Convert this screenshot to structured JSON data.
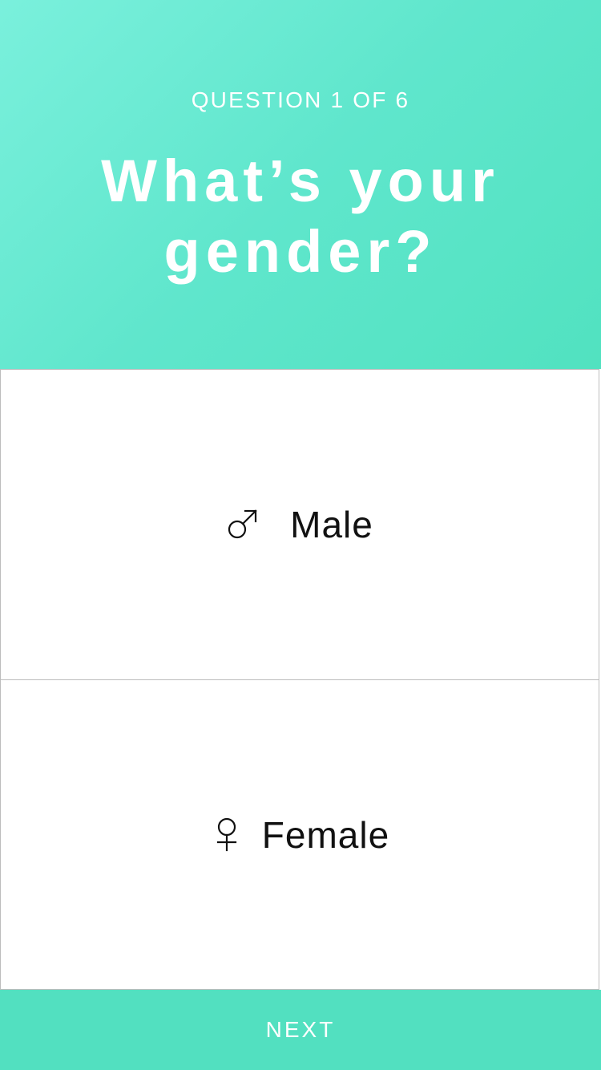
{
  "header": {
    "progress": "QUESTION 1 OF 6",
    "title_line_1": "What’s your",
    "title_line_2": "gender?"
  },
  "options": [
    {
      "label": "Male",
      "icon": "male-symbol-icon"
    },
    {
      "label": "Female",
      "icon": "female-symbol-icon"
    }
  ],
  "footer": {
    "next_label": "NEXT"
  },
  "colors": {
    "header_gradient_start": "#7af0dc",
    "header_gradient_end": "#51e2c0",
    "next_bar": "#52e0c0",
    "divider": "#bdbdbd"
  }
}
